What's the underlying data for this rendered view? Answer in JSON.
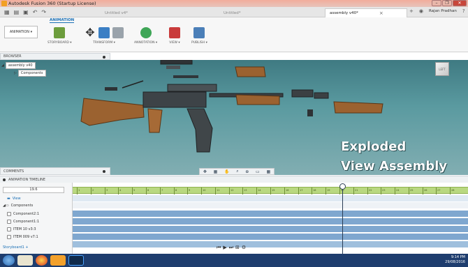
{
  "window": {
    "title": "Autodesk Fusion 360 (Startup License)",
    "controls": [
      "–",
      "❐",
      "✕"
    ]
  },
  "tabs": [
    {
      "label": "Untitled v4*",
      "active": false
    },
    {
      "label": "Untitled*",
      "active": false
    },
    {
      "label": "assembly v40*",
      "active": true
    }
  ],
  "user": {
    "name": "Rajan Pradhan"
  },
  "toolbar": {
    "workspace": "ANIMATION ▾",
    "active_tab": "ANIMATION",
    "groups": [
      "STORYBOARD ▾",
      "TRANSFORM ▾",
      "ANNOTATION ▾",
      "VIEW ▾",
      "PUBLISH ▾"
    ]
  },
  "browser": {
    "header": "BROWSER",
    "root": "assembly v40",
    "child": "Components"
  },
  "viewport": {
    "overlay_line1": "Exploded",
    "overlay_line2": "View Assembly",
    "comments": "COMMENTS"
  },
  "timeline": {
    "header": "ANIMATION TIMELINE",
    "time": "19.6",
    "rows": [
      "View",
      "Components",
      "Component2:1",
      "Component1:1",
      "ITEM 10 v3:3",
      "ITEM 009 v7:1"
    ],
    "storyboard": "Storyboard1",
    "ruler_ticks": [
      "1",
      "2",
      "3",
      "4",
      "5",
      "6",
      "7",
      "8",
      "9",
      "10",
      "11",
      "12",
      "13",
      "14",
      "15",
      "16",
      "17",
      "18",
      "19",
      "20",
      "21",
      "22",
      "23",
      "24",
      "25",
      "26",
      "27",
      "28"
    ]
  },
  "taskbar": {
    "time": "9:14 PM",
    "date": "29/08/2016"
  },
  "colors": {
    "viewport_top": "#3f7a82",
    "viewport_bottom": "#82aeb2",
    "timeline_ruler": "#b9d880",
    "track_blue": "#7fa7cf",
    "taskbar": "#1e3d6e"
  }
}
